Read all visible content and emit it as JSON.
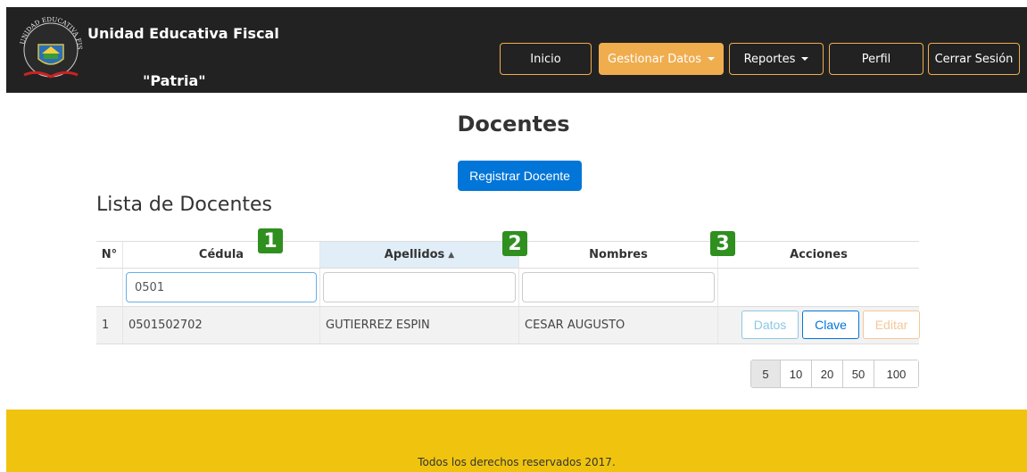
{
  "brand": {
    "line1": "Unidad Educativa Fiscal",
    "line2": "\"Patria\"",
    "seal_text": "UNIDAD EDUCATIVA FISCAL"
  },
  "nav": [
    {
      "label": "Inicio",
      "dropdown": false,
      "active": false
    },
    {
      "label": "Gestionar Datos",
      "dropdown": true,
      "active": true
    },
    {
      "label": "Reportes",
      "dropdown": true,
      "active": false
    },
    {
      "label": "Perfil",
      "dropdown": false,
      "active": false
    },
    {
      "label": "Cerrar Sesión",
      "dropdown": false,
      "active": false
    }
  ],
  "page": {
    "title": "Docentes",
    "register_label": "Registrar Docente",
    "list_title": "Lista de Docentes"
  },
  "table": {
    "columns": [
      "N°",
      "Cédula",
      "Apellidos",
      "Nombres",
      "Acciones"
    ],
    "sorted_column": "Apellidos",
    "filters": {
      "cedula": "0501",
      "apellidos": "",
      "nombres": ""
    },
    "rows": [
      {
        "n": "1",
        "cedula": "0501502702",
        "apellidos": "GUTIERREZ ESPIN",
        "nombres": "CESAR AUGUSTO"
      }
    ],
    "actions": {
      "data": "Datos",
      "key": "Clave",
      "edit": "Editar"
    }
  },
  "badges": [
    "1",
    "2",
    "3"
  ],
  "pagination": {
    "sizes": [
      "5",
      "10",
      "20",
      "50",
      "100"
    ],
    "active": "5"
  },
  "footer": {
    "text": "Todos los derechos reservados 2017."
  },
  "colors": {
    "navbar": "#222222",
    "accent": "#f0ad4e",
    "primary": "#0275d8",
    "footer": "#f0c40e",
    "badge": "#2f8f1f"
  }
}
